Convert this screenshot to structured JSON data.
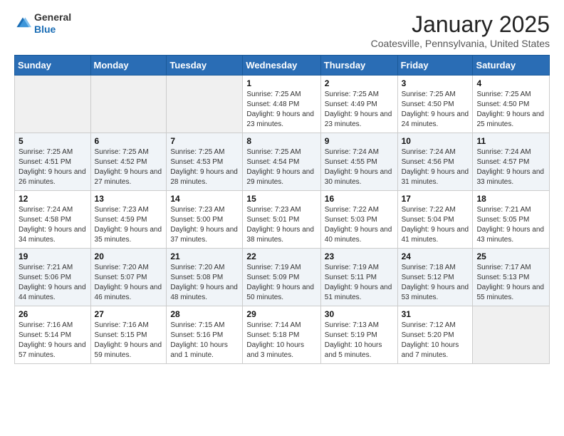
{
  "header": {
    "logo_line1": "General",
    "logo_line2": "Blue",
    "month_title": "January 2025",
    "location": "Coatesville, Pennsylvania, United States"
  },
  "days_of_week": [
    "Sunday",
    "Monday",
    "Tuesday",
    "Wednesday",
    "Thursday",
    "Friday",
    "Saturday"
  ],
  "weeks": [
    [
      {
        "day": "",
        "info": ""
      },
      {
        "day": "",
        "info": ""
      },
      {
        "day": "",
        "info": ""
      },
      {
        "day": "1",
        "info": "Sunrise: 7:25 AM\nSunset: 4:48 PM\nDaylight: 9 hours and 23 minutes."
      },
      {
        "day": "2",
        "info": "Sunrise: 7:25 AM\nSunset: 4:49 PM\nDaylight: 9 hours and 23 minutes."
      },
      {
        "day": "3",
        "info": "Sunrise: 7:25 AM\nSunset: 4:50 PM\nDaylight: 9 hours and 24 minutes."
      },
      {
        "day": "4",
        "info": "Sunrise: 7:25 AM\nSunset: 4:50 PM\nDaylight: 9 hours and 25 minutes."
      }
    ],
    [
      {
        "day": "5",
        "info": "Sunrise: 7:25 AM\nSunset: 4:51 PM\nDaylight: 9 hours and 26 minutes."
      },
      {
        "day": "6",
        "info": "Sunrise: 7:25 AM\nSunset: 4:52 PM\nDaylight: 9 hours and 27 minutes."
      },
      {
        "day": "7",
        "info": "Sunrise: 7:25 AM\nSunset: 4:53 PM\nDaylight: 9 hours and 28 minutes."
      },
      {
        "day": "8",
        "info": "Sunrise: 7:25 AM\nSunset: 4:54 PM\nDaylight: 9 hours and 29 minutes."
      },
      {
        "day": "9",
        "info": "Sunrise: 7:24 AM\nSunset: 4:55 PM\nDaylight: 9 hours and 30 minutes."
      },
      {
        "day": "10",
        "info": "Sunrise: 7:24 AM\nSunset: 4:56 PM\nDaylight: 9 hours and 31 minutes."
      },
      {
        "day": "11",
        "info": "Sunrise: 7:24 AM\nSunset: 4:57 PM\nDaylight: 9 hours and 33 minutes."
      }
    ],
    [
      {
        "day": "12",
        "info": "Sunrise: 7:24 AM\nSunset: 4:58 PM\nDaylight: 9 hours and 34 minutes."
      },
      {
        "day": "13",
        "info": "Sunrise: 7:23 AM\nSunset: 4:59 PM\nDaylight: 9 hours and 35 minutes."
      },
      {
        "day": "14",
        "info": "Sunrise: 7:23 AM\nSunset: 5:00 PM\nDaylight: 9 hours and 37 minutes."
      },
      {
        "day": "15",
        "info": "Sunrise: 7:23 AM\nSunset: 5:01 PM\nDaylight: 9 hours and 38 minutes."
      },
      {
        "day": "16",
        "info": "Sunrise: 7:22 AM\nSunset: 5:03 PM\nDaylight: 9 hours and 40 minutes."
      },
      {
        "day": "17",
        "info": "Sunrise: 7:22 AM\nSunset: 5:04 PM\nDaylight: 9 hours and 41 minutes."
      },
      {
        "day": "18",
        "info": "Sunrise: 7:21 AM\nSunset: 5:05 PM\nDaylight: 9 hours and 43 minutes."
      }
    ],
    [
      {
        "day": "19",
        "info": "Sunrise: 7:21 AM\nSunset: 5:06 PM\nDaylight: 9 hours and 44 minutes."
      },
      {
        "day": "20",
        "info": "Sunrise: 7:20 AM\nSunset: 5:07 PM\nDaylight: 9 hours and 46 minutes."
      },
      {
        "day": "21",
        "info": "Sunrise: 7:20 AM\nSunset: 5:08 PM\nDaylight: 9 hours and 48 minutes."
      },
      {
        "day": "22",
        "info": "Sunrise: 7:19 AM\nSunset: 5:09 PM\nDaylight: 9 hours and 50 minutes."
      },
      {
        "day": "23",
        "info": "Sunrise: 7:19 AM\nSunset: 5:11 PM\nDaylight: 9 hours and 51 minutes."
      },
      {
        "day": "24",
        "info": "Sunrise: 7:18 AM\nSunset: 5:12 PM\nDaylight: 9 hours and 53 minutes."
      },
      {
        "day": "25",
        "info": "Sunrise: 7:17 AM\nSunset: 5:13 PM\nDaylight: 9 hours and 55 minutes."
      }
    ],
    [
      {
        "day": "26",
        "info": "Sunrise: 7:16 AM\nSunset: 5:14 PM\nDaylight: 9 hours and 57 minutes."
      },
      {
        "day": "27",
        "info": "Sunrise: 7:16 AM\nSunset: 5:15 PM\nDaylight: 9 hours and 59 minutes."
      },
      {
        "day": "28",
        "info": "Sunrise: 7:15 AM\nSunset: 5:16 PM\nDaylight: 10 hours and 1 minute."
      },
      {
        "day": "29",
        "info": "Sunrise: 7:14 AM\nSunset: 5:18 PM\nDaylight: 10 hours and 3 minutes."
      },
      {
        "day": "30",
        "info": "Sunrise: 7:13 AM\nSunset: 5:19 PM\nDaylight: 10 hours and 5 minutes."
      },
      {
        "day": "31",
        "info": "Sunrise: 7:12 AM\nSunset: 5:20 PM\nDaylight: 10 hours and 7 minutes."
      },
      {
        "day": "",
        "info": ""
      }
    ]
  ]
}
